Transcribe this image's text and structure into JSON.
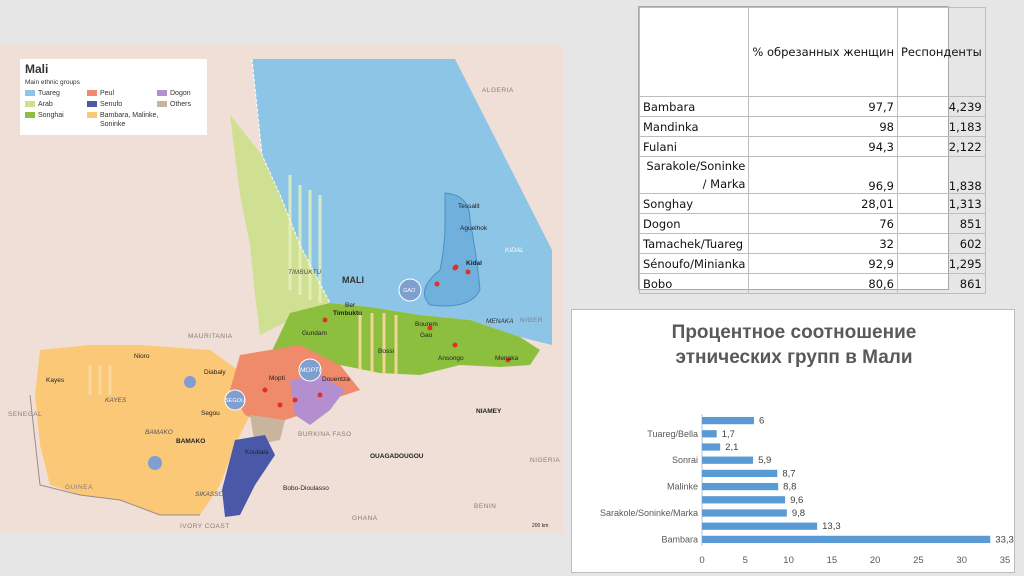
{
  "map": {
    "legend": {
      "title": "Mali",
      "subtitle": "Main ethnic groups",
      "items": [
        {
          "label": "Tuareg",
          "color": "#8cc5e6"
        },
        {
          "label": "Arab",
          "color": "#cfe093"
        },
        {
          "label": "Songhai",
          "color": "#8dbf3f"
        },
        {
          "label": "Peul",
          "color": "#ef8a6a"
        },
        {
          "label": "Senufo",
          "color": "#4a58a8"
        },
        {
          "label": "Bambara, Malinke, Soninke",
          "color": "#fbc878"
        },
        {
          "label": "Dogon",
          "color": "#b48fd0"
        },
        {
          "label": "Others",
          "color": "#c9b49e"
        }
      ]
    },
    "country_labels": [
      "ALGERIA",
      "MAURITANIA",
      "SENEGAL",
      "GUINEA",
      "IVORY COAST",
      "GHANA",
      "BURKINA FASO",
      "NIGERIA",
      "BENIN",
      "NIGER"
    ],
    "main_label": "MALI",
    "region_labels": [
      "TIMBUKTU",
      "KIDAL",
      "MENAKA",
      "MOPTI",
      "KAYES",
      "BAMAKO",
      "SIKASSO",
      "SEGOU",
      "GAO"
    ],
    "cities": [
      "Tessalit",
      "Aguelhok",
      "Kidal",
      "Ber",
      "Timbuktu",
      "Gundam",
      "Bourem",
      "Gao",
      "Bossi",
      "Ansongo",
      "Menaka",
      "Nioro",
      "Kayes",
      "Diabaly",
      "Mopti",
      "Douentza",
      "Segou",
      "BAMAKO",
      "Koutiala",
      "Bobo-Dioulasso",
      "OUAGADOUGOU",
      "NIAMEY"
    ],
    "scale": "200 km"
  },
  "table": {
    "headers": [
      "",
      "% обрезанных женщин",
      "Респонденты"
    ],
    "rows": [
      [
        "Bambara",
        "97,7",
        "4,239"
      ],
      [
        "Mandinka",
        "98",
        "1,183"
      ],
      [
        "Fulani",
        "94,3",
        "2,122"
      ],
      [
        "Sarakole/Soninke / Marka",
        "96,9",
        "1,838"
      ],
      [
        "Songhay",
        "28,01",
        "1,313"
      ],
      [
        "Dogon",
        "76",
        "851"
      ],
      [
        "Tamachek/Tuareg",
        "32",
        "602"
      ],
      [
        "Sénoufo/Minianka",
        "92,9",
        "1,295"
      ],
      [
        "Bobo",
        "80,6",
        "861"
      ]
    ]
  },
  "chart_data": {
    "type": "bar",
    "orientation": "horizontal",
    "title": "Процентное соотношение этнических групп в Мали",
    "title_lines": [
      "Процентное соотношение",
      "этнических групп в Мали"
    ],
    "categories": [
      "Bambara",
      "",
      "Sarakole/Soninke/Marka",
      "",
      "Malinke",
      "",
      "Sonrai",
      "",
      "Tuareg/Bella",
      ""
    ],
    "values": [
      33.3,
      13.3,
      9.8,
      9.6,
      8.8,
      8.7,
      5.9,
      2.1,
      1.7,
      6
    ],
    "value_labels": [
      "33,3",
      "13,3",
      "9,8",
      "9,6",
      "8,8",
      "8,7",
      "5,9",
      "2,1",
      "1,7",
      "6"
    ],
    "xlim": [
      0,
      35
    ],
    "xticks": [
      0,
      5,
      10,
      15,
      20,
      25,
      30,
      35
    ],
    "grid": false,
    "bar_color": "#5b9bd5"
  }
}
